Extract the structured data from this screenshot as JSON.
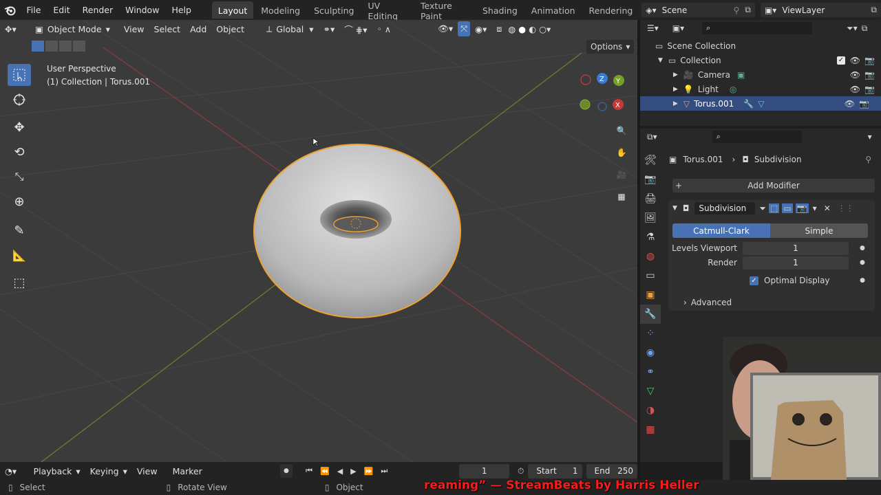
{
  "menus": [
    "File",
    "Edit",
    "Render",
    "Window",
    "Help"
  ],
  "workspaces": [
    {
      "label": "Layout",
      "active": true
    },
    {
      "label": "Modeling",
      "active": false
    },
    {
      "label": "Sculpting",
      "active": false
    },
    {
      "label": "UV Editing",
      "active": false
    },
    {
      "label": "Texture Paint",
      "active": false
    },
    {
      "label": "Shading",
      "active": false
    },
    {
      "label": "Animation",
      "active": false
    },
    {
      "label": "Rendering",
      "active": false
    }
  ],
  "scene_name": "Scene",
  "view_layer": "ViewLayer",
  "viewport": {
    "mode": "Object Mode",
    "menu": [
      "View",
      "Select",
      "Add",
      "Object"
    ],
    "transform_orientation": "Global",
    "options_label": "Options",
    "info_line1": "User Perspective",
    "info_line2": "(1) Collection | Torus.001",
    "gizmo": {
      "x": "X",
      "y": "Y",
      "z": "Z"
    }
  },
  "outliner": {
    "root": "Scene Collection",
    "collection": "Collection",
    "items": [
      {
        "label": "Camera",
        "icon": "camera-icon",
        "selected": false
      },
      {
        "label": "Light",
        "icon": "light-icon",
        "selected": false
      },
      {
        "label": "Torus.001",
        "icon": "mesh-icon",
        "selected": true
      }
    ]
  },
  "properties": {
    "object_name": "Torus.001",
    "modifier_tab": "Subdivision",
    "add_modifier": "Add Modifier",
    "modifier": {
      "name": "Subdivision",
      "methods": [
        "Catmull-Clark",
        "Simple"
      ],
      "active_method": "Catmull-Clark",
      "levels_viewport_label": "Levels Viewport",
      "levels_viewport": "1",
      "render_label": "Render",
      "render": "1",
      "optimal_display_label": "Optimal Display",
      "optimal_display": true,
      "advanced_label": "Advanced"
    }
  },
  "timeline": {
    "menus": [
      "Playback",
      "Keying",
      "View",
      "Marker"
    ],
    "current_frame": "1",
    "start_label": "Start",
    "start": "1",
    "end_label": "End",
    "end": "250"
  },
  "statusbar": {
    "select": "Select",
    "rotate": "Rotate View",
    "object": "Object"
  },
  "overlay_caption": "reaming” — StreamBeats by Harris Heller",
  "colors": {
    "accent": "#4772b3",
    "selection_outline": "#f0a030",
    "viewport_bg": "#3b3b3b",
    "panel_bg": "#282828"
  }
}
